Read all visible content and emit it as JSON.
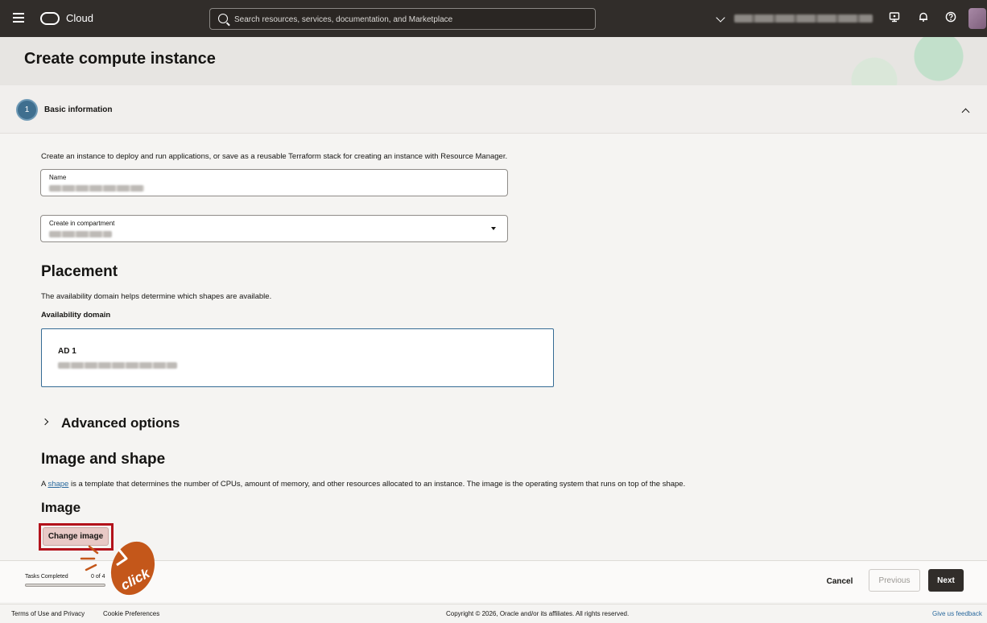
{
  "topbar": {
    "brand": "Cloud",
    "search_placeholder": "Search resources, services, documentation, and Marketplace",
    "icons": [
      "menu-icon",
      "cloud-logo",
      "search-icon",
      "chevron-down-icon",
      "developer-tools-icon",
      "bell-icon",
      "help-icon",
      "avatar"
    ]
  },
  "page": {
    "title": "Create compute instance"
  },
  "step": {
    "number": "1",
    "title": "Basic information"
  },
  "basic": {
    "intro": "Create an instance to deploy and run applications, or save as a reusable Terraform stack for creating an instance with Resource Manager.",
    "name_label": "Name",
    "compartment_label": "Create in compartment"
  },
  "placement": {
    "heading": "Placement",
    "description": "The availability domain helps determine which shapes are available.",
    "ad_label": "Availability domain",
    "ad_option": "AD 1"
  },
  "advanced": {
    "label": "Advanced options"
  },
  "image_shape": {
    "heading": "Image and shape",
    "desc_prefix": "A ",
    "desc_link": "shape",
    "desc_suffix": " is a template that determines the number of CPUs, amount of memory, and other resources allocated to an instance. The image is the operating system that runs on top of the shape.",
    "image_heading": "Image",
    "change_image_label": "Change image"
  },
  "annotation": {
    "badge_text": "click",
    "highlight_color": "#b3121b",
    "badge_color": "#c4571a"
  },
  "action_bar": {
    "tasks_label": "Tasks Completed",
    "tasks_count": "0 of 4",
    "tasks_progress": 0,
    "cancel": "Cancel",
    "previous": "Previous",
    "next": "Next"
  },
  "footer": {
    "terms": "Terms of Use and Privacy",
    "cookies": "Cookie Preferences",
    "copyright": "Copyright © 2026, Oracle and/or its affiliates. All rights reserved.",
    "feedback": "Give us feedback"
  },
  "colors": {
    "topbar": "#312d2a",
    "step_circle": "#3f6f8f",
    "ad_border": "#356b94",
    "link": "#2b6a9e",
    "next_button": "#312d2a"
  }
}
